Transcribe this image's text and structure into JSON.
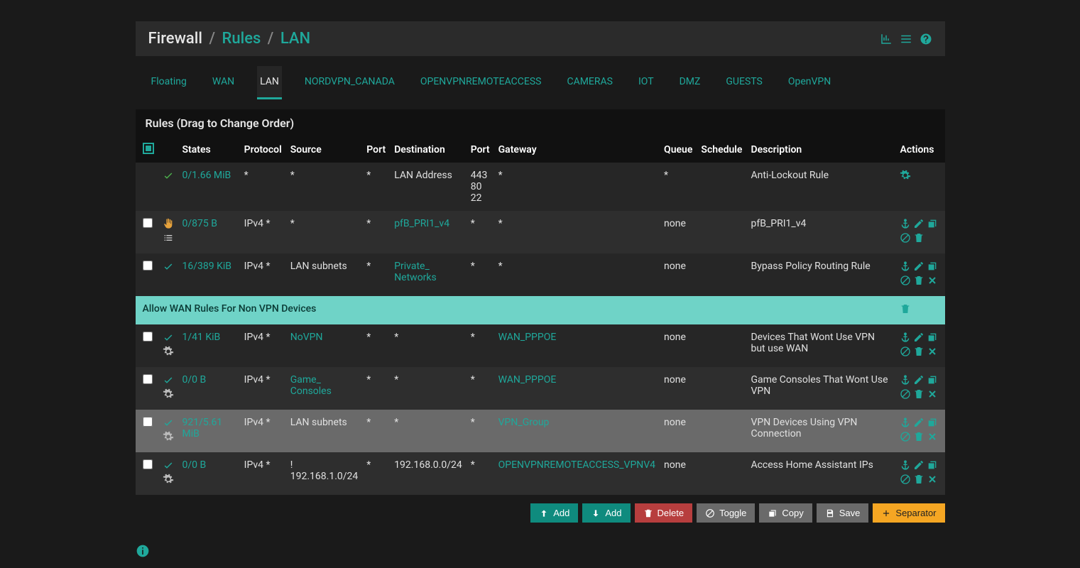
{
  "breadcrumb": {
    "root": "Firewall",
    "mid": "Rules",
    "leaf": "LAN"
  },
  "tabs": [
    "Floating",
    "WAN",
    "LAN",
    "NORDVPN_CANADA",
    "OPENVPNREMOTEACCESS",
    "CAMERAS",
    "IOT",
    "DMZ",
    "GUESTS",
    "OpenVPN"
  ],
  "active_tab": "LAN",
  "panel_title": "Rules (Drag to Change Order)",
  "columns": [
    "",
    "",
    "States",
    "Protocol",
    "Source",
    "Port",
    "Destination",
    "Port",
    "Gateway",
    "Queue",
    "Schedule",
    "Description",
    "Actions"
  ],
  "separator_label": "Allow WAN Rules For Non VPN Devices",
  "rows": [
    {
      "type": "rule",
      "checkbox": false,
      "status": "check-green",
      "cog": false,
      "states": "0/1.66 MiB",
      "protocol": "*",
      "source": "*",
      "sport": "*",
      "dest": "LAN Address",
      "dest_link": false,
      "dport": "443\n80\n22",
      "gateway": "*",
      "queue": "*",
      "schedule": "",
      "desc": "Anti-Lockout Rule",
      "actions": "gear"
    },
    {
      "type": "rule",
      "checkbox": true,
      "status": "block",
      "cog": false,
      "list": true,
      "states": "0/875 B",
      "protocol": "IPv4 *",
      "source": "*",
      "sport": "*",
      "dest": "pfB_PRI1_v4",
      "dest_link": true,
      "dport": "*",
      "gateway": "*",
      "queue": "none",
      "schedule": "",
      "desc": "pfB_PRI1_v4",
      "actions": "full-nocross"
    },
    {
      "type": "rule",
      "checkbox": true,
      "status": "check-teal",
      "cog": false,
      "states": "16/389 KiB",
      "protocol": "IPv4 *",
      "source": "LAN subnets",
      "sport": "*",
      "dest": "Private_\nNetworks",
      "dest_link": true,
      "dport": "*",
      "gateway": "*",
      "queue": "none",
      "schedule": "",
      "desc": "Bypass Policy Routing Rule",
      "actions": "full"
    },
    {
      "type": "separator"
    },
    {
      "type": "rule",
      "checkbox": true,
      "status": "check-teal",
      "cog": true,
      "states": "1/41 KiB",
      "protocol": "IPv4 *",
      "source": "NoVPN",
      "source_link": true,
      "sport": "*",
      "dest": "*",
      "dport": "*",
      "gateway": "WAN_PPPOE",
      "gateway_link": true,
      "queue": "none",
      "schedule": "",
      "desc": "Devices That Wont Use VPN but use WAN",
      "actions": "full"
    },
    {
      "type": "rule",
      "checkbox": true,
      "status": "check-teal",
      "cog": true,
      "states": "0/0 B",
      "protocol": "IPv4 *",
      "source": "Game_\nConsoles",
      "source_link": true,
      "sport": "*",
      "dest": "*",
      "dport": "*",
      "gateway": "WAN_PPPOE",
      "gateway_link": true,
      "queue": "none",
      "schedule": "",
      "desc": "Game Consoles That Wont Use VPN",
      "actions": "full"
    },
    {
      "type": "rule",
      "checkbox": true,
      "selected": true,
      "status": "check-teal",
      "cog": true,
      "states": "921/5.61 MiB",
      "protocol": "IPv4 *",
      "source": "LAN subnets",
      "sport": "*",
      "dest": "*",
      "dport": "*",
      "gateway": "VPN_Group",
      "gateway_link": true,
      "queue": "none",
      "schedule": "",
      "desc": "VPN Devices Using VPN Connection",
      "actions": "full"
    },
    {
      "type": "rule",
      "checkbox": true,
      "status": "check-teal",
      "cog": true,
      "states": "0/0 B",
      "protocol": "IPv4 *",
      "source": "!\n192.168.1.0/24",
      "sport": "*",
      "dest": "192.168.0.0/24",
      "dport": "*",
      "gateway": "OPENVPNREMOTEACCESS_VPNV4",
      "gateway_link": true,
      "queue": "none",
      "schedule": "",
      "desc": "Access Home Assistant IPs",
      "actions": "full"
    }
  ],
  "buttons": {
    "add_up": "Add",
    "add_down": "Add",
    "delete": "Delete",
    "toggle": "Toggle",
    "copy": "Copy",
    "save": "Save",
    "separator": "Separator"
  }
}
